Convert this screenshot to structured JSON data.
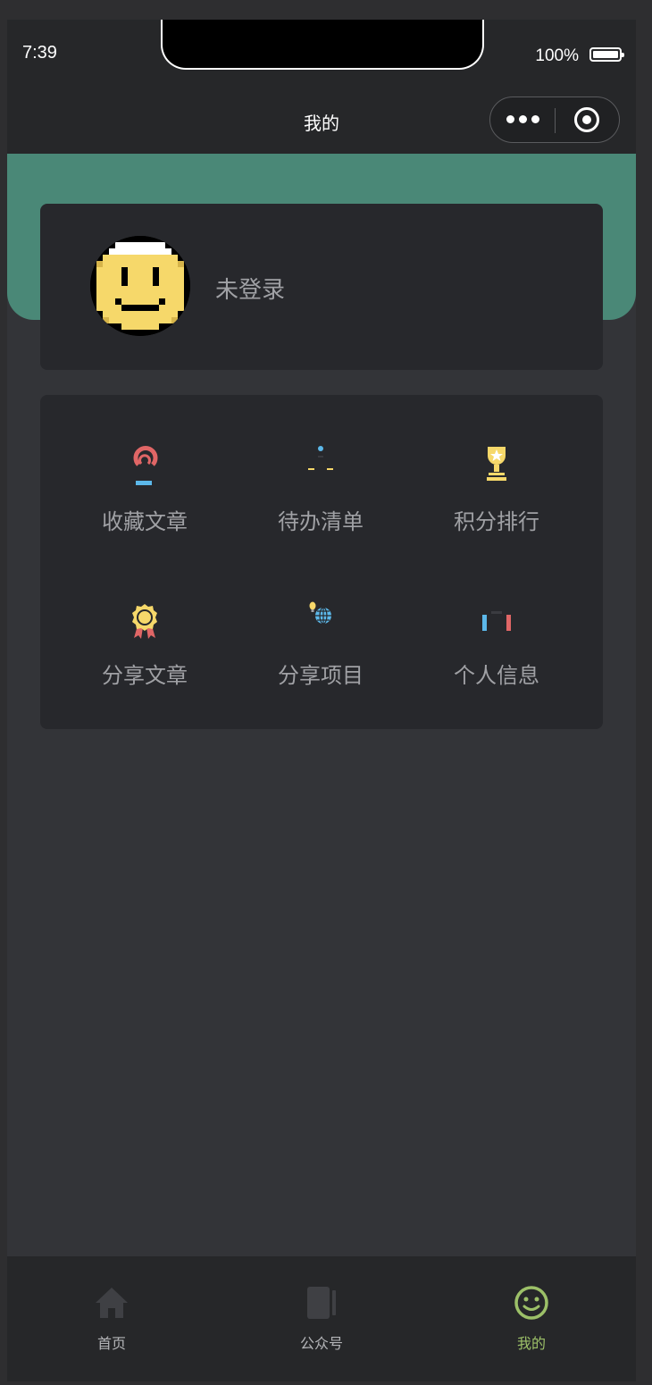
{
  "status_bar": {
    "time": "7:39",
    "battery_percent": "100%"
  },
  "nav": {
    "title": "我的",
    "capsule_more_icon": "more-dots-icon",
    "capsule_close_icon": "target-icon"
  },
  "profile": {
    "avatar_icon": "pixel-smiley-avatar",
    "login_status": "未登录"
  },
  "menu": {
    "items": [
      {
        "label": "收藏文章",
        "icon": "favorite-icon"
      },
      {
        "label": "待办清单",
        "icon": "todo-icon"
      },
      {
        "label": "积分排行",
        "icon": "trophy-icon"
      },
      {
        "label": "分享文章",
        "icon": "medal-icon"
      },
      {
        "label": "分享项目",
        "icon": "globe-idea-icon"
      },
      {
        "label": "个人信息",
        "icon": "profile-info-icon"
      }
    ]
  },
  "tabbar": {
    "items": [
      {
        "label": "首页",
        "icon": "home-icon",
        "active": false
      },
      {
        "label": "公众号",
        "icon": "book-icon",
        "active": false
      },
      {
        "label": "我的",
        "icon": "smiley-icon",
        "active": true
      }
    ]
  },
  "colors": {
    "banner": "#4a8877",
    "card": "#27282c",
    "page": "#333438",
    "active_tab": "#9cc068",
    "text_muted": "#a0a1a5"
  }
}
